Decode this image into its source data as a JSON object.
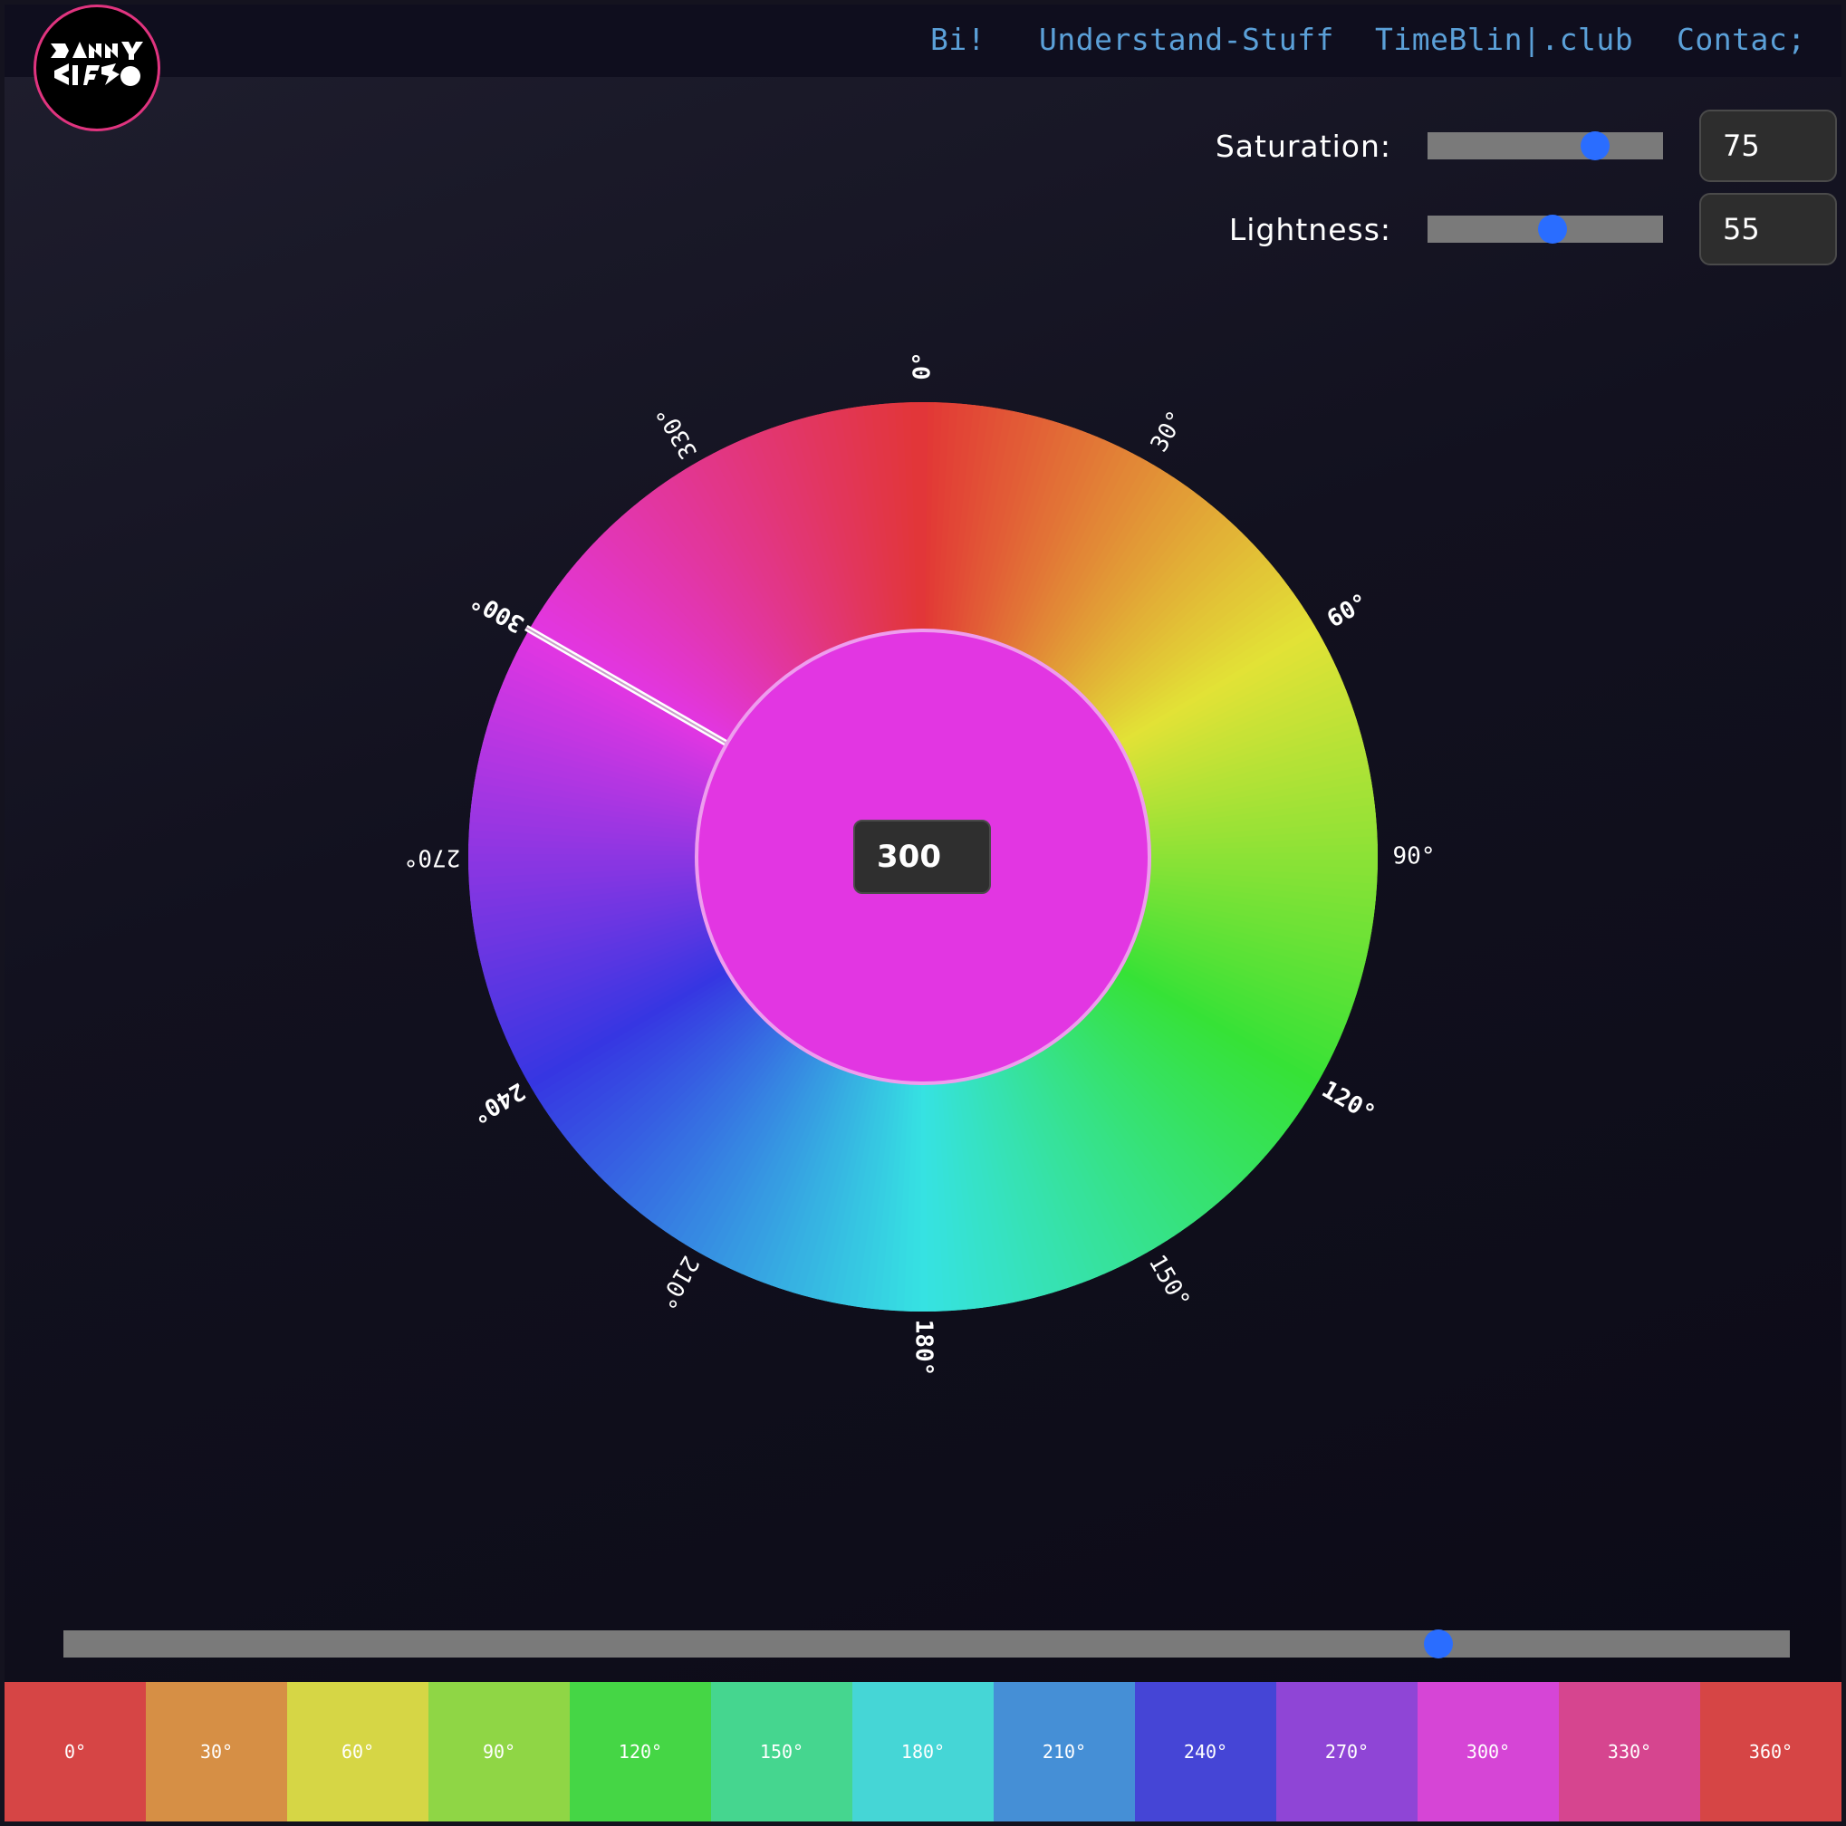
{
  "nav": {
    "items": [
      "Bi!",
      "Understand-Stuff",
      "TimeBlin|.club",
      "Contac;"
    ]
  },
  "controls": {
    "saturation": {
      "label": "Saturation:",
      "value": "75",
      "fraction": 0.75
    },
    "lightness": {
      "label": "Lightness:",
      "value": "55",
      "fraction": 0.55
    }
  },
  "wheel": {
    "hue_value": "300",
    "selected_hue": 300,
    "saturation": 75,
    "lightness": 55,
    "ticks": [
      "0°",
      "30°",
      "60°",
      "90°",
      "120°",
      "150°",
      "180°",
      "210°",
      "240°",
      "270°",
      "300°",
      "330°"
    ]
  },
  "hue_slider": {
    "value": 300,
    "max": 360
  },
  "swatches": [
    {
      "label": "0°",
      "color": "#d64545"
    },
    {
      "label": "30°",
      "color": "#d68f45"
    },
    {
      "label": "60°",
      "color": "#d6d645"
    },
    {
      "label": "90°",
      "color": "#8fd645"
    },
    {
      "label": "120°",
      "color": "#45d645"
    },
    {
      "label": "150°",
      "color": "#45d68f"
    },
    {
      "label": "180°",
      "color": "#45d6d6"
    },
    {
      "label": "210°",
      "color": "#458fd6"
    },
    {
      "label": "240°",
      "color": "#4545d6"
    },
    {
      "label": "270°",
      "color": "#8f45d6"
    },
    {
      "label": "300°",
      "color": "#d645d6"
    },
    {
      "label": "330°",
      "color": "#d6458f"
    },
    {
      "label": "360°",
      "color": "#d64545"
    }
  ],
  "colors": {
    "accent": "#2a6dff",
    "nav_link": "#5ba0d8",
    "logo_ring": "#e0347f"
  }
}
